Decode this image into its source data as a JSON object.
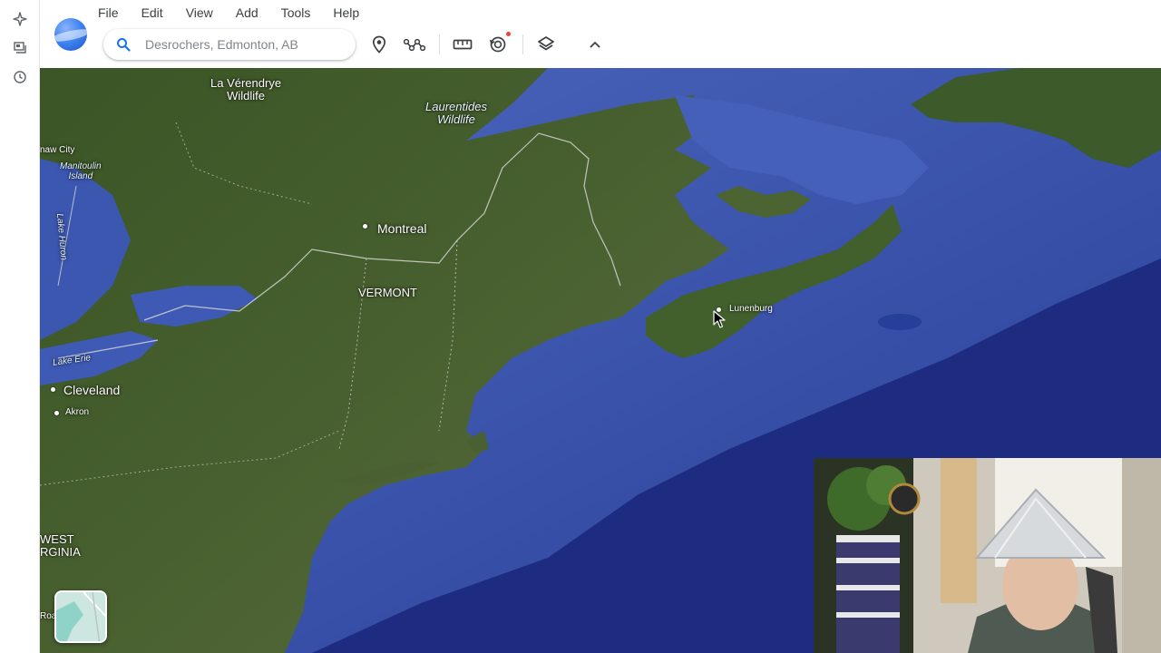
{
  "rail": {
    "items": [
      {
        "name": "sparkle-icon"
      },
      {
        "name": "projects-icon"
      },
      {
        "name": "history-icon"
      }
    ]
  },
  "menu": {
    "items": [
      "File",
      "Edit",
      "View",
      "Add",
      "Tools",
      "Help"
    ]
  },
  "search": {
    "placeholder": "Desrochers, Edmonton, AB",
    "value": ""
  },
  "toolbar": {
    "tools": [
      {
        "name": "placemark-icon"
      },
      {
        "name": "path-icon"
      },
      {
        "name": "measure-ruler-icon"
      },
      {
        "name": "historical-imagery-icon",
        "has_notification": true
      },
      {
        "name": "map-style-layers-icon"
      },
      {
        "name": "chevron-up-icon"
      }
    ]
  },
  "map": {
    "labels": {
      "la_verendrye": "La Vérendrye\nWildlife",
      "laurentides": "Laurentides\nWildlife",
      "naw_city": "naw City",
      "manitoulin": "Manitoulin\nIsland",
      "lake_huron": "Lake Huron",
      "montreal": "Montreal",
      "vermont": "VERMONT",
      "lunenburg": "Lunenburg",
      "lake_erie": "Lake Erie",
      "cleveland": "Cleveland",
      "akron": "Akron",
      "west_virginia": "WEST\nRGINIA",
      "roa": "Roa"
    }
  },
  "colors": {
    "ocean_deep": "#1d2f86",
    "ocean_shelf": "#3f5cb8",
    "land": "#3f5a2a",
    "accent": "#1a73e8",
    "notification": "#ea4335"
  }
}
